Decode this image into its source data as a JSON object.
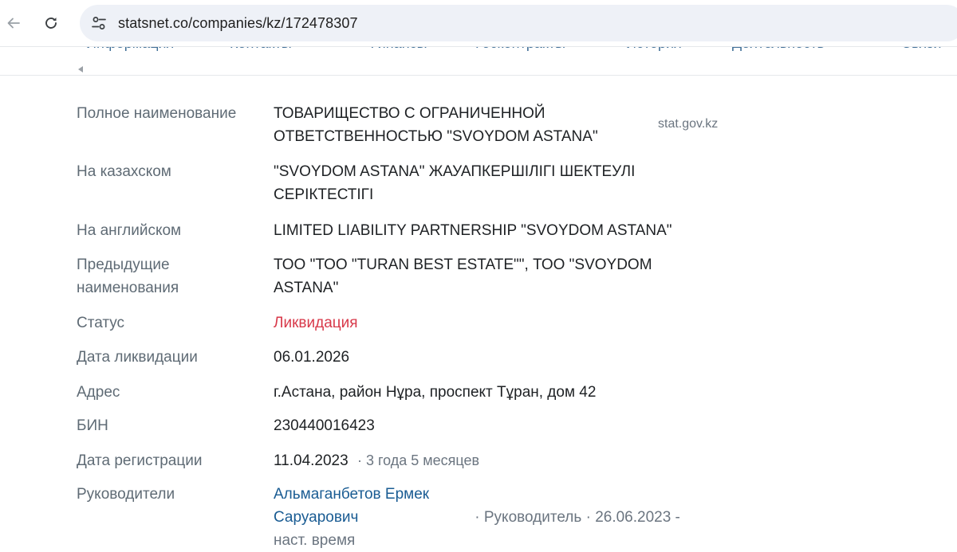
{
  "browser": {
    "url": "statsnet.co/companies/kz/172478307"
  },
  "tabs": [
    {
      "label": "Информация"
    },
    {
      "label": "Контакты"
    },
    {
      "label": "Финансы"
    },
    {
      "label": "Госконтракты"
    },
    {
      "label": "История"
    },
    {
      "label": "Деятельность"
    },
    {
      "label": "Связи"
    }
  ],
  "source_label": "stat.gov.kz",
  "details": {
    "full_name": {
      "label": "Полное наименование",
      "value": "ТОВАРИЩЕСТВО С ОГРАНИЧЕННОЙ ОТВЕТСТВЕННОСТЬЮ \"SVOYDOM ASTANA\""
    },
    "kazakh": {
      "label": "На казахском",
      "value": "\"SVOYDOM ASTANA\" ЖАУАПКЕРШІЛІГІ ШЕКТЕУЛІ СЕРІКТЕСТІГІ"
    },
    "english": {
      "label": "На английском",
      "value": "LIMITED LIABILITY PARTNERSHIP \"SVOYDOM ASTANA\""
    },
    "previous": {
      "label": "Предыдущие наименования",
      "value": "ТОО \"ТОО \"TURAN BEST ESTATE\"\", ТОО \"SVOYDOM ASTANA\""
    },
    "status": {
      "label": "Статус",
      "value": "Ликвидация",
      "color": "#d8394a"
    },
    "liquidation_date": {
      "label": "Дата ликвидации",
      "value": "06.01.2026"
    },
    "address": {
      "label": "Адрес",
      "value": "г.Астана, район Нұра, проспект Тұран, дом 42"
    },
    "bin": {
      "label": "БИН",
      "value": "230440016423"
    },
    "registration": {
      "label": "Дата регистрации",
      "value": "11.04.2023",
      "age": "· 3 года 5 месяцев"
    },
    "managers": {
      "label": "Руководители",
      "name": "Альмаганбетов Ермек Саруарович",
      "role": "· Руководитель ·",
      "period": "26.06.2023 - наст. время"
    }
  }
}
